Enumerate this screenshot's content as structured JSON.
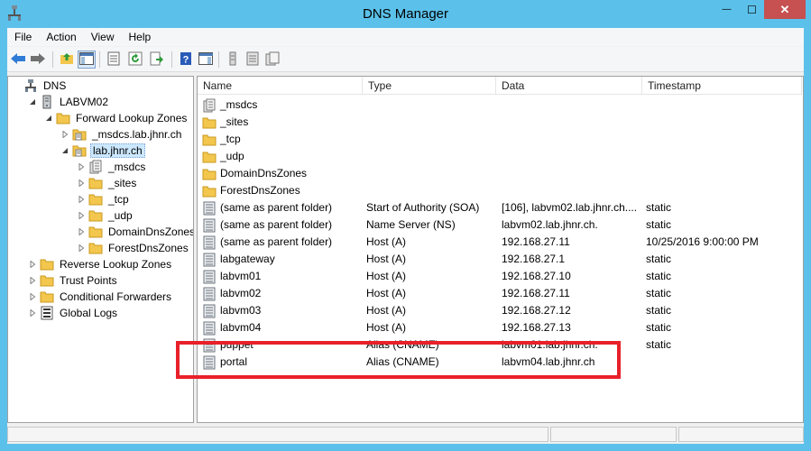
{
  "window": {
    "title": "DNS Manager",
    "minimize_glyph": "—",
    "maximize_glyph": "☐",
    "close_glyph": "✕"
  },
  "menu": [
    "File",
    "Action",
    "View",
    "Help"
  ],
  "toolbar": {
    "icons": [
      "back-icon",
      "forward-icon",
      "up-folder-icon",
      "show-console-tree-icon",
      "properties-icon",
      "refresh-icon",
      "export-list-icon",
      "help-icon",
      "show-action-pane-icon",
      "new-record-icon",
      "list-icon",
      "copy-icon"
    ]
  },
  "tree": [
    {
      "label": "DNS",
      "depth": 0,
      "expander": "",
      "icon": "dns-icon"
    },
    {
      "label": "LABVM02",
      "depth": 1,
      "expander": "open",
      "icon": "server-icon"
    },
    {
      "label": "Forward Lookup Zones",
      "depth": 2,
      "expander": "open",
      "icon": "folder-icon"
    },
    {
      "label": "_msdcs.lab.jhnr.ch",
      "depth": 3,
      "expander": "closed",
      "icon": "zone-icon"
    },
    {
      "label": "lab.jhnr.ch",
      "depth": 3,
      "expander": "open",
      "icon": "zone-icon",
      "selected": true
    },
    {
      "label": "_msdcs",
      "depth": 4,
      "expander": "closed",
      "icon": "delegated-zone-icon"
    },
    {
      "label": "_sites",
      "depth": 4,
      "expander": "closed",
      "icon": "folder-icon"
    },
    {
      "label": "_tcp",
      "depth": 4,
      "expander": "closed",
      "icon": "folder-icon"
    },
    {
      "label": "_udp",
      "depth": 4,
      "expander": "closed",
      "icon": "folder-icon"
    },
    {
      "label": "DomainDnsZones",
      "depth": 4,
      "expander": "closed",
      "icon": "folder-icon"
    },
    {
      "label": "ForestDnsZones",
      "depth": 4,
      "expander": "closed",
      "icon": "folder-icon"
    },
    {
      "label": "Reverse Lookup Zones",
      "depth": 1,
      "expander": "closed",
      "icon": "folder-icon"
    },
    {
      "label": "Trust Points",
      "depth": 1,
      "expander": "closed",
      "icon": "folder-icon"
    },
    {
      "label": "Conditional Forwarders",
      "depth": 1,
      "expander": "closed",
      "icon": "folder-icon"
    },
    {
      "label": "Global Logs",
      "depth": 1,
      "expander": "closed",
      "icon": "logs-icon"
    }
  ],
  "columns": [
    "Name",
    "Type",
    "Data",
    "Timestamp"
  ],
  "records": [
    {
      "name": "_msdcs",
      "type": "",
      "data": "",
      "timestamp": "",
      "icon": "delegated-zone-icon"
    },
    {
      "name": "_sites",
      "type": "",
      "data": "",
      "timestamp": "",
      "icon": "folder-icon"
    },
    {
      "name": "_tcp",
      "type": "",
      "data": "",
      "timestamp": "",
      "icon": "folder-icon"
    },
    {
      "name": "_udp",
      "type": "",
      "data": "",
      "timestamp": "",
      "icon": "folder-icon"
    },
    {
      "name": "DomainDnsZones",
      "type": "",
      "data": "",
      "timestamp": "",
      "icon": "folder-icon"
    },
    {
      "name": "ForestDnsZones",
      "type": "",
      "data": "",
      "timestamp": "",
      "icon": "folder-icon"
    },
    {
      "name": "(same as parent folder)",
      "type": "Start of Authority (SOA)",
      "data": "[106], labvm02.lab.jhnr.ch....",
      "timestamp": "static",
      "icon": "record-icon"
    },
    {
      "name": "(same as parent folder)",
      "type": "Name Server (NS)",
      "data": "labvm02.lab.jhnr.ch.",
      "timestamp": "static",
      "icon": "record-icon"
    },
    {
      "name": "(same as parent folder)",
      "type": "Host (A)",
      "data": "192.168.27.11",
      "timestamp": "10/25/2016 9:00:00 PM",
      "icon": "record-icon"
    },
    {
      "name": "labgateway",
      "type": "Host (A)",
      "data": "192.168.27.1",
      "timestamp": "static",
      "icon": "record-icon"
    },
    {
      "name": "labvm01",
      "type": "Host (A)",
      "data": "192.168.27.10",
      "timestamp": "static",
      "icon": "record-icon"
    },
    {
      "name": "labvm02",
      "type": "Host (A)",
      "data": "192.168.27.11",
      "timestamp": "static",
      "icon": "record-icon"
    },
    {
      "name": "labvm03",
      "type": "Host (A)",
      "data": "192.168.27.12",
      "timestamp": "static",
      "icon": "record-icon"
    },
    {
      "name": "labvm04",
      "type": "Host (A)",
      "data": "192.168.27.13",
      "timestamp": "static",
      "icon": "record-icon"
    },
    {
      "name": "puppet",
      "type": "Alias (CNAME)",
      "data": "labvm01.lab.jhnr.ch.",
      "timestamp": "static",
      "icon": "record-icon"
    },
    {
      "name": "portal",
      "type": "Alias (CNAME)",
      "data": "labvm04.lab.jhnr.ch",
      "timestamp": "",
      "icon": "record-icon"
    }
  ],
  "colors": {
    "title_bar": "#5bc1ea",
    "close_button": "#c75050",
    "annotation": "#e8202a",
    "selection": "#cce8ff",
    "folder": "#f3c74d"
  }
}
